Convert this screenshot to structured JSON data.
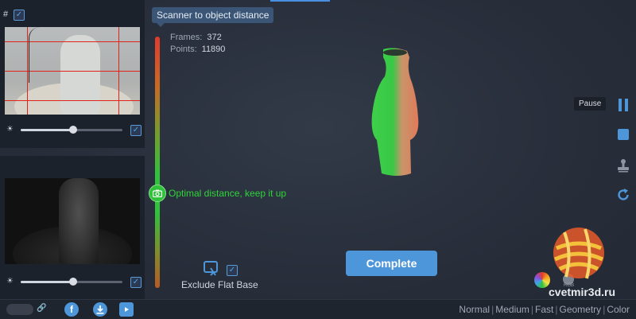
{
  "left_panel": {
    "hash_label": "#",
    "checkbox_mark": "✓"
  },
  "tooltip": {
    "text": "Scanner to object distance"
  },
  "stats": {
    "frames_label": "Frames:",
    "frames_value": "372",
    "points_label": "Points:",
    "points_value": "11890"
  },
  "distance_message": "Optimal distance, keep it up",
  "exclude_flat_base": {
    "label": "Exclude Flat Base",
    "checked": true
  },
  "complete_button": {
    "label": "Complete"
  },
  "right_toolbar": {
    "pause_tooltip": "Pause",
    "items": [
      "pause-icon",
      "stop-icon",
      "stamp-icon",
      "refresh-icon"
    ]
  },
  "rgb_label": "RGB",
  "watermark_text": "cvetmir3d.ru",
  "footer": {
    "modes": [
      "Normal",
      "Medium",
      "Fast",
      "Geometry",
      "Color"
    ],
    "facebook_letter": "f"
  },
  "colors": {
    "accent": "#4d96d9",
    "ok_green": "#2fc23a",
    "guide_red": "#e2231a"
  }
}
